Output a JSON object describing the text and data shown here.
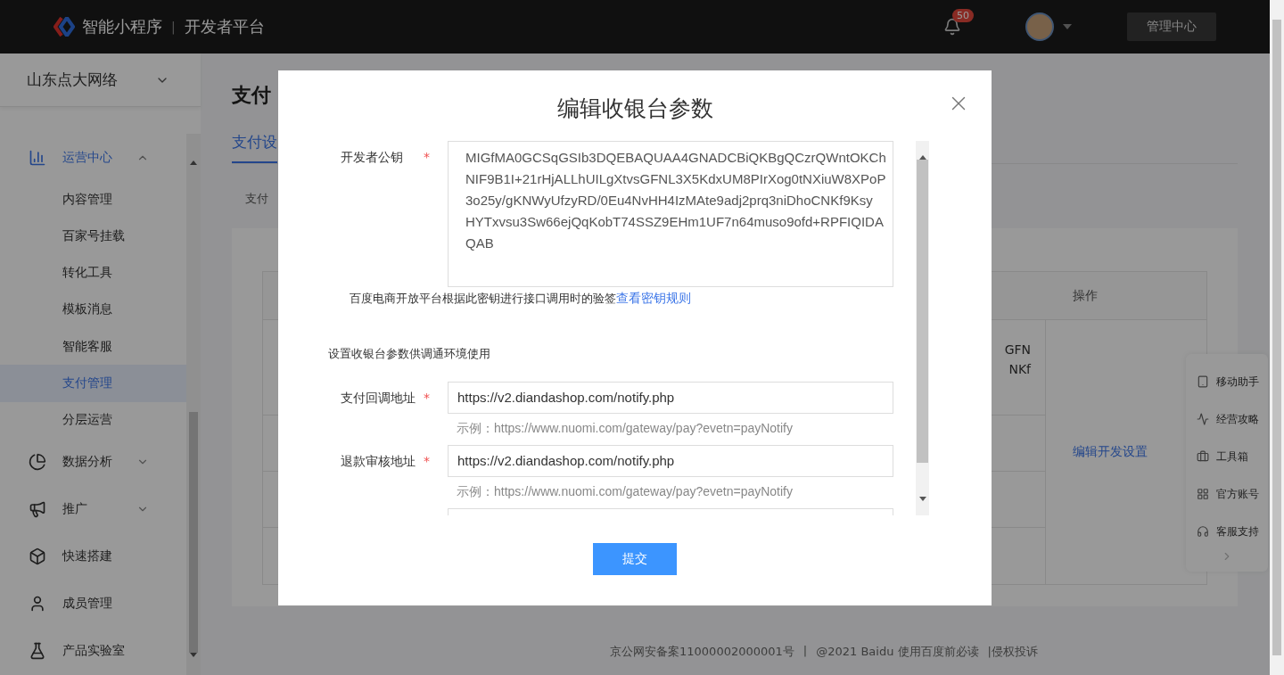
{
  "header": {
    "logo_text": "智能小程序",
    "separator": "|",
    "platform": "开发者平台",
    "notification_count": "50",
    "admin_button": "管理中心"
  },
  "sidebar": {
    "account": "山东点大网络",
    "items": [
      {
        "label": "运营中心",
        "selected": true,
        "expanded": true,
        "children": [
          {
            "label": "内容管理",
            "selected": false
          },
          {
            "label": "百家号挂载",
            "selected": false
          },
          {
            "label": "转化工具",
            "selected": false
          },
          {
            "label": "模板消息",
            "selected": false
          },
          {
            "label": "智能客服",
            "selected": false
          },
          {
            "label": "支付管理",
            "selected": true
          },
          {
            "label": "分层运营",
            "selected": false
          }
        ]
      },
      {
        "label": "数据分析",
        "selected": false,
        "expanded": false
      },
      {
        "label": "推广",
        "selected": false,
        "expanded": false
      },
      {
        "label": "快速搭建",
        "selected": false
      },
      {
        "label": "成员管理",
        "selected": false
      },
      {
        "label": "产品实验室",
        "selected": false
      }
    ]
  },
  "main": {
    "title": "支付",
    "tabs": [
      {
        "label": "支付设",
        "selected": true
      }
    ],
    "subtab": "支付",
    "table": {
      "action_header": "操作",
      "cell_lines": [
        "GFN",
        "NKf"
      ],
      "action_link": "编辑开发设置"
    }
  },
  "float_panel": {
    "items": [
      "移动助手",
      "经营攻略",
      "工具箱",
      "官方账号",
      "客服支持"
    ]
  },
  "footer": [
    "京公网安备案11000002000001号",
    "|",
    "@2021 Baidu 使用百度前必读",
    "|侵权投诉"
  ],
  "modal": {
    "title": "编辑收银台参数",
    "public_key": {
      "label": "开发者公钥",
      "required_mark": "*",
      "value": "MIGfMA0GCSqGSIb3DQEBAQUAA4GNADCBiQKBgQCzrQWntOKCh\nNIF9B1I+21rHjALLhUILgXtvsGFNL3X5KdxUM8PIrXog0tNXiuW8XPoP\n3o25y/gKNWyUfzyRD/0Eu4NvHH4IzMAte9adj2prq3niDhoCNKf9Ksy\nHYTxvsu3Sw66ejQqKobT74SSZ9EHm1UF7n64muso9ofd+RPFIQIDA\nQAB"
    },
    "key_hint": "百度电商开放平台根据此密钥进行接口调用时的验签",
    "key_hint_link": "查看密钥规则",
    "section": "设置收银台参数供调通环境使用",
    "fields": [
      {
        "label": "支付回调地址",
        "required_mark": "*",
        "value": "https://v2.diandashop.com/notify.php",
        "example": "示例：https://www.nuomi.com/gateway/pay?evetn=payNotify"
      },
      {
        "label": "退款审核地址",
        "required_mark": "*",
        "value": "https://v2.diandashop.com/notify.php",
        "example": "示例：https://www.nuomi.com/gateway/pay?evetn=payNotify"
      }
    ],
    "submit": "提交"
  }
}
